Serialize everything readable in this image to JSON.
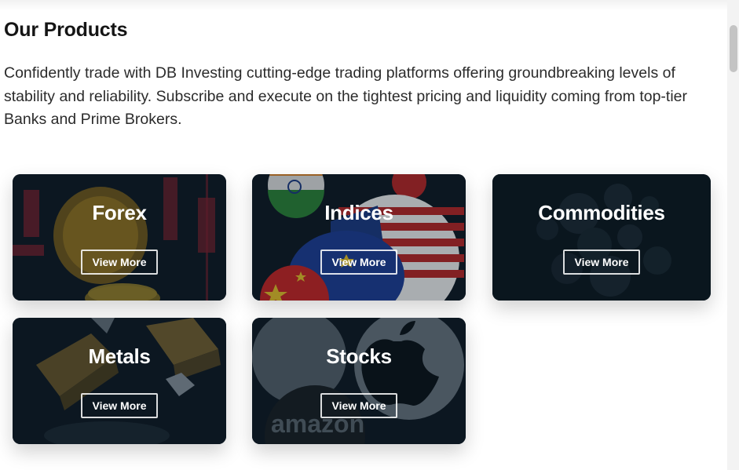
{
  "section": {
    "title": "Our Products",
    "description": "Confidently trade with DB Investing cutting-edge trading platforms offering groundbreaking levels of stability and reliability. Subscribe and execute on the tightest pricing and liquidity coming from top-tier Banks and Prime Brokers."
  },
  "products": [
    {
      "title": "Forex",
      "button": "View More",
      "icon": "coins-candlestick-icon"
    },
    {
      "title": "Indices",
      "button": "View More",
      "icon": "flag-spheres-icon"
    },
    {
      "title": "Commodities",
      "button": "View More",
      "icon": "molecule-spheres-icon"
    },
    {
      "title": "Metals",
      "button": "View More",
      "icon": "gold-bars-icon"
    },
    {
      "title": "Stocks",
      "button": "View More",
      "icon": "company-logos-icon",
      "art_text": "amazon"
    }
  ]
}
